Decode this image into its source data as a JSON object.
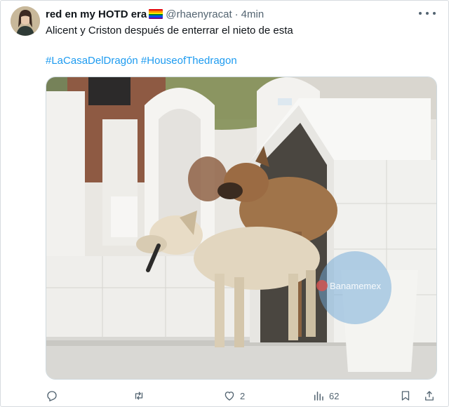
{
  "tweet": {
    "display_name": "red en my HOTD era",
    "handle": "@rhaenyracat",
    "separator": "·",
    "time": "4min",
    "text": "Alicent y Criston después de enterrar el nieto de esta",
    "hashtags": [
      "#LaCasaDelDragón",
      "#HouseofThedragon"
    ]
  },
  "media": {
    "watermark": "Banamemex"
  },
  "actions": {
    "reply_count": "",
    "retweet_count": "",
    "like_count": "2",
    "views_count": "62"
  },
  "icons": {
    "avatar": "avatar",
    "flag": "rainbow-flag-icon",
    "more": "more-options-icon",
    "reply": "reply-icon",
    "retweet": "retweet-icon",
    "like": "heart-icon",
    "views": "views-icon",
    "bookmark": "bookmark-icon",
    "share": "share-icon"
  },
  "colors": {
    "link": "#1d9bf0",
    "text": "#0f1419",
    "muted": "#536471",
    "flag": [
      "#e40303",
      "#ff8c00",
      "#ffed00",
      "#008026",
      "#004dff",
      "#750787"
    ]
  }
}
